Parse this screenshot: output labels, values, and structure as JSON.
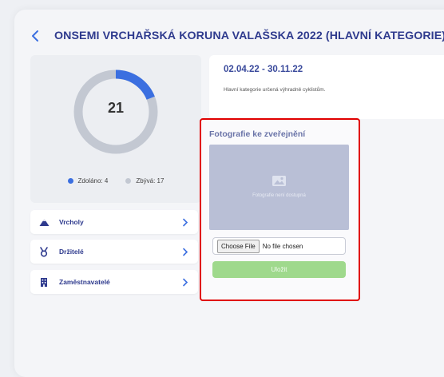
{
  "header": {
    "title": "ONSEMI VRCHAŘSKÁ KORUNA VALAŠSKA 2022 (HLAVNÍ KATEGORIE)"
  },
  "stats": {
    "count": "21",
    "completed_label": "Zdoláno: 4",
    "remaining_label": "Zbývá: 17",
    "completed_fraction": 0.19,
    "colors": {
      "completed": "#3b6fe0",
      "remaining": "#c3c8d2"
    }
  },
  "nav": {
    "items": [
      {
        "label": "Vrcholy",
        "icon": "mountain-icon"
      },
      {
        "label": "Držitelé",
        "icon": "medal-icon"
      },
      {
        "label": "Zaměstnavatelé",
        "icon": "building-icon"
      }
    ]
  },
  "info": {
    "date_range": "02.04.22 - 30.11.22",
    "description": "Hlavní kategorie určená výhradně cyklistům."
  },
  "photo": {
    "title": "Fotografie ke zveřejnění",
    "placeholder_text": "Fotografie není dostupná",
    "file_button_label": "Choose File",
    "file_status": "No file chosen",
    "save_label": "Uložit"
  },
  "colors": {
    "accent": "#2f3b8e",
    "highlight_border": "#e00000",
    "save_button": "#9fd98c"
  }
}
